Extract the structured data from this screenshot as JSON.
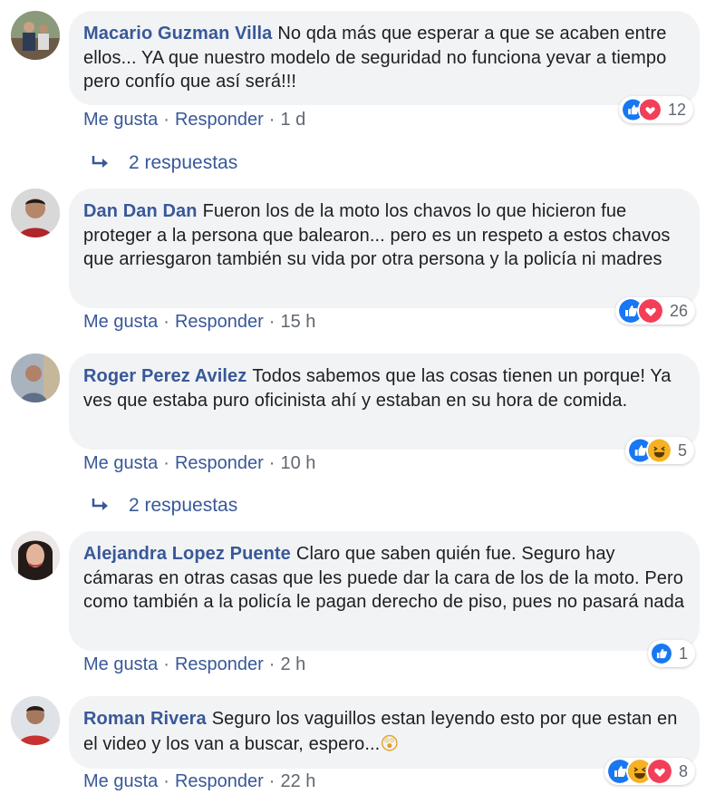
{
  "colors": {
    "link": "#385898",
    "bubble": "#f2f3f5",
    "muted": "#606770",
    "like": "#1877f2",
    "love": "#f33e58",
    "haha": "#f7b125"
  },
  "comments": [
    {
      "author": "Macario Guzman Villa",
      "text": "No qda más que esperar a que se acaben entre ellos... YA que nuestro modelo de seguridad no funciona yevar a tiempo pero confío que así será!!!",
      "like": "Me gusta",
      "sep1": "·",
      "reply": "Responder",
      "sep2": "·",
      "time": "1 d",
      "reactions": [
        "like-icon",
        "love-icon"
      ],
      "reaction_count": "12",
      "replies": "2 respuestas"
    },
    {
      "author": "Dan Dan Dan",
      "text": "Fueron los de la moto los chavos lo que hicieron fue proteger a la persona que balearon... pero es un respeto a estos chavos que arriesgaron también su vida por otra persona y la policía ni madres",
      "like": "Me gusta",
      "sep1": "·",
      "reply": "Responder",
      "sep2": "·",
      "time": "15 h",
      "reactions": [
        "like-icon",
        "love-icon"
      ],
      "reaction_count": "26"
    },
    {
      "author": "Roger Perez Avilez",
      "text": "Todos sabemos que las cosas tienen un porque! Ya ves que estaba puro oficinista ahí y estaban en su hora de comida.",
      "like": "Me gusta",
      "sep1": "·",
      "reply": "Responder",
      "sep2": "·",
      "time": "10 h",
      "reactions": [
        "like-icon",
        "haha-icon"
      ],
      "reaction_count": "5",
      "replies": "2 respuestas"
    },
    {
      "author": "Alejandra Lopez Puente",
      "text": "Claro que saben quién fue. Seguro hay cámaras en otras casas que les puede dar la cara de los de la moto. Pero como también a la policía le pagan derecho de piso, pues no pasará nada",
      "like": "Me gusta",
      "sep1": "·",
      "reply": "Responder",
      "sep2": "·",
      "time": "2 h",
      "reactions": [
        "like-icon"
      ],
      "reaction_count": "1"
    },
    {
      "author": "Roman Rivera",
      "text": "Seguro los vaguillos estan leyendo esto por que estan en el video y los van a buscar, espero...",
      "emoji": "😲",
      "like": "Me gusta",
      "sep1": "·",
      "reply": "Responder",
      "sep2": "·",
      "time": "22 h",
      "reactions": [
        "like-icon",
        "haha-icon",
        "love-icon"
      ],
      "reaction_count": "8"
    }
  ]
}
